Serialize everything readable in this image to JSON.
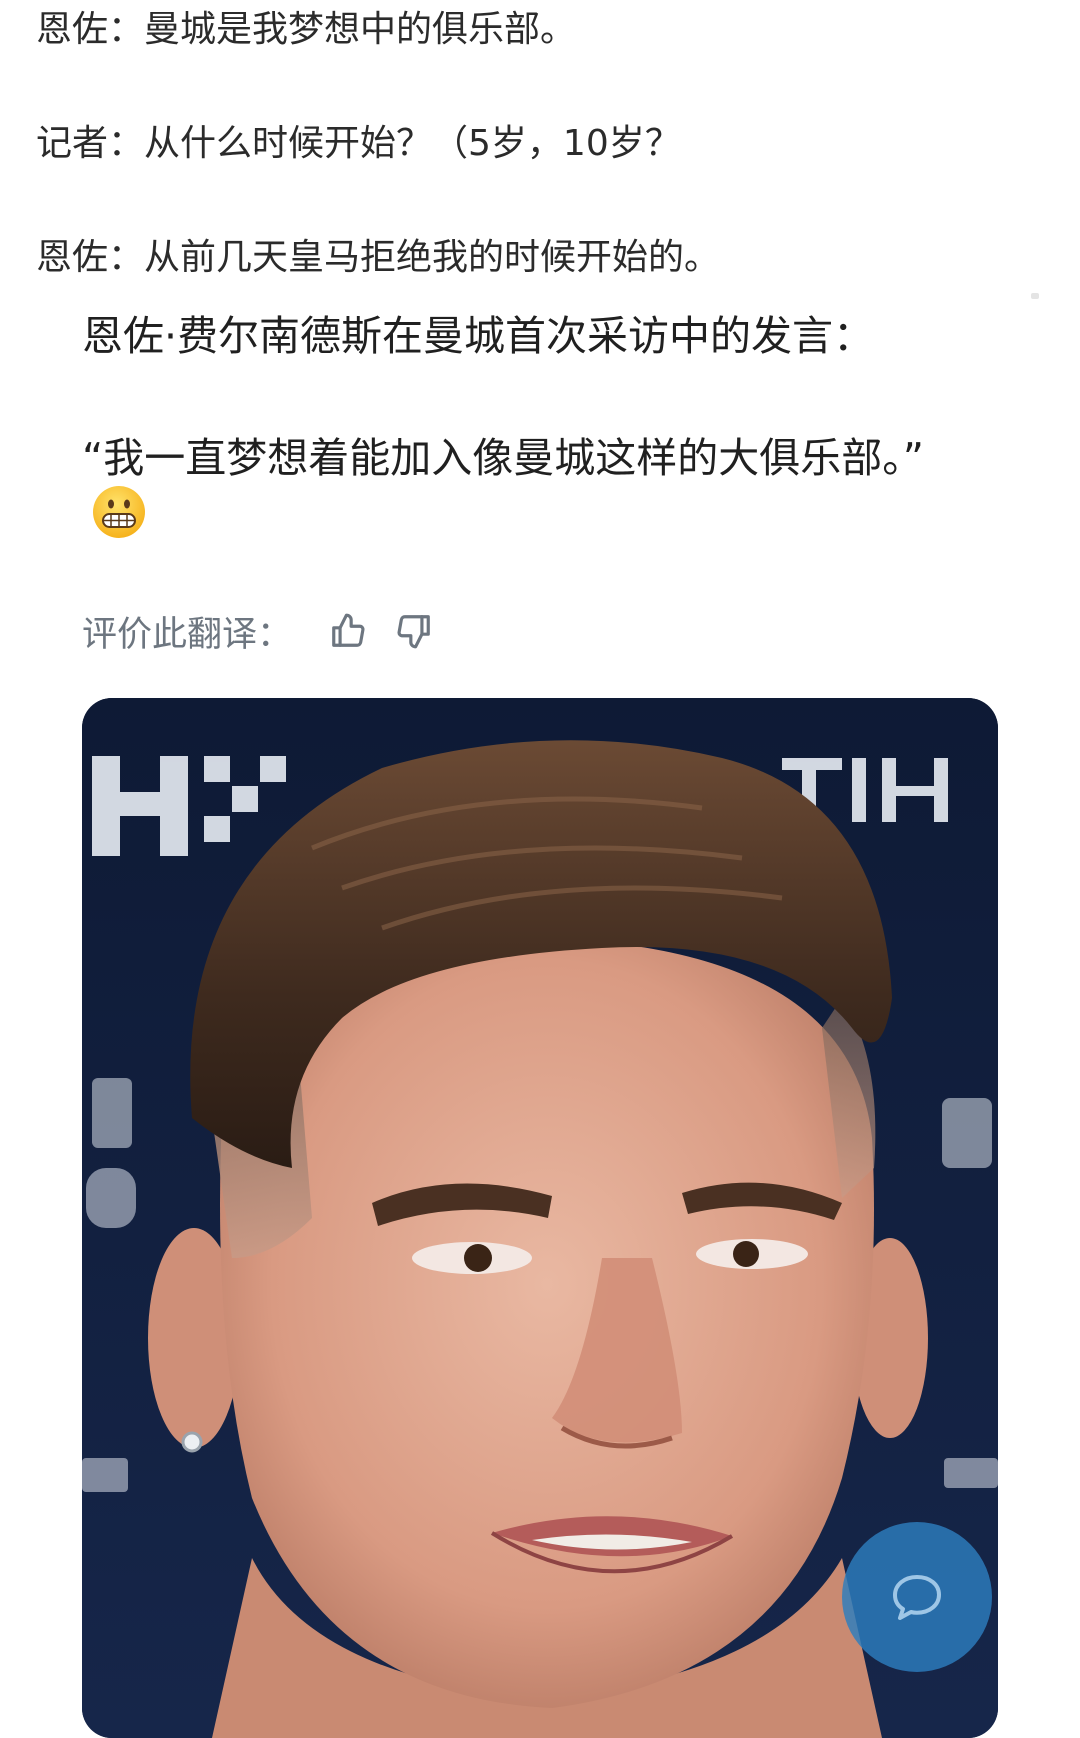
{
  "dialogue": [
    {
      "speaker": "恩佐：",
      "text": "曼城是我梦想中的俱乐部。"
    },
    {
      "speaker": "记者：",
      "text": "从什么时候开始？（5岁，10岁？"
    },
    {
      "speaker": "恩佐：",
      "text": "从前几天皇马拒绝我的时候开始的。"
    }
  ],
  "translated_post": {
    "heading": "恩佐·费尔南德斯在曼城首次采访中的发言：",
    "quote": "“我一直梦想着能加入像曼城这样的大俱乐部。”",
    "emoji": "grimacing-face-emoji"
  },
  "translation_rating": {
    "label": "评价此翻译：",
    "up_icon": "thumbs-up-icon",
    "down_icon": "thumbs-down-icon"
  },
  "photo": {
    "subject": "press-conference-photo"
  },
  "fab": {
    "icon": "comment-bubble-icon",
    "color": "#2d7ebe"
  }
}
